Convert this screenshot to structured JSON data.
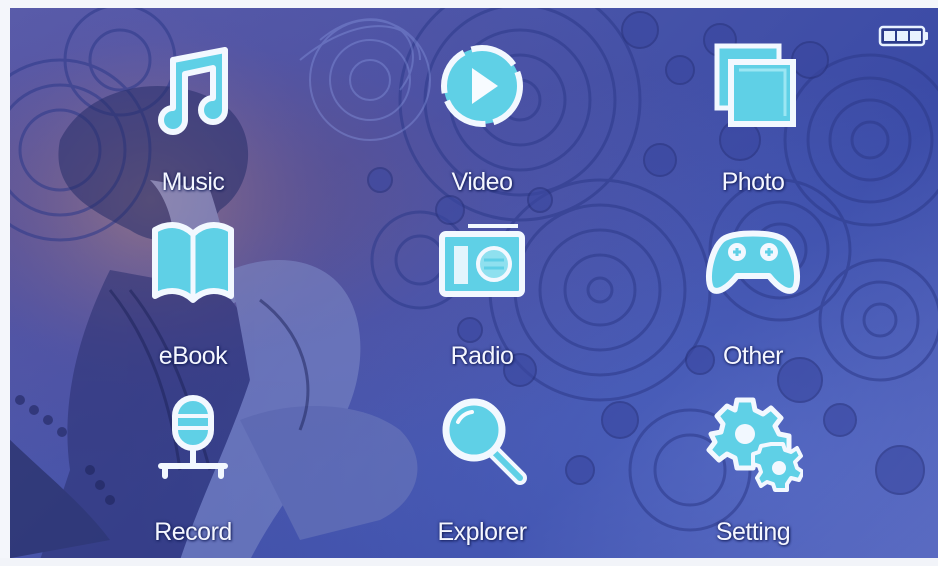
{
  "menu": {
    "items": [
      {
        "label": "Music",
        "icon": "music-note-icon"
      },
      {
        "label": "Video",
        "icon": "play-icon"
      },
      {
        "label": "Photo",
        "icon": "photo-icon"
      },
      {
        "label": "eBook",
        "icon": "book-icon"
      },
      {
        "label": "Radio",
        "icon": "radio-icon"
      },
      {
        "label": "Other",
        "icon": "gamepad-icon"
      },
      {
        "label": "Record",
        "icon": "microphone-icon"
      },
      {
        "label": "Explorer",
        "icon": "magnifier-icon"
      },
      {
        "label": "Setting",
        "icon": "gears-icon"
      }
    ]
  },
  "status": {
    "battery_icon": "battery-icon",
    "battery_level": 1.0
  },
  "colors": {
    "icon_fill": "#5fd0e6",
    "icon_outline": "#f2f8ff",
    "label_text": "#f4f6ff",
    "background": "#4552a8"
  }
}
